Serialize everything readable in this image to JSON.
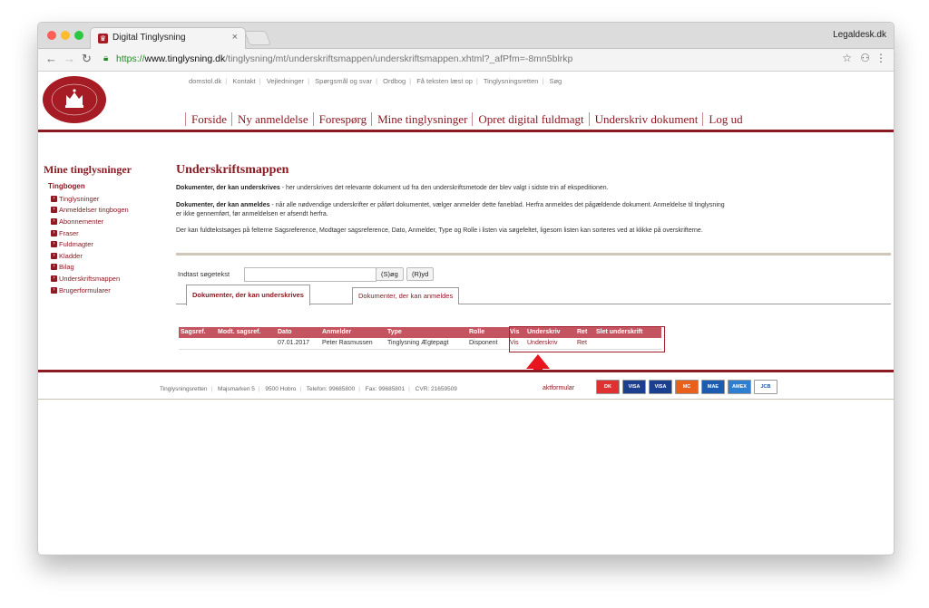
{
  "browser": {
    "tab_title": "Digital Tinglysning",
    "tab_close": "×",
    "profile_name": "Legaldesk.dk",
    "url_scheme": "https://",
    "url_host": "www.tinglysning.dk",
    "url_path": "/tinglysning/mt/underskriftsmappen/underskriftsmappen.xhtml?_afPfm=-8mn5blrkp"
  },
  "site": {
    "utility_links": [
      "domstol.dk",
      "Kontakt",
      "Vejledninger",
      "Spørgsmål og svar",
      "Ordbog",
      "Få teksten læst op",
      "Tinglysningsretten",
      "Søg"
    ],
    "main_nav": [
      "Forside",
      "Ny anmeldelse",
      "Forespørg",
      "Mine tinglysninger",
      "Opret digital fuldmagt",
      "Underskriv dokument",
      "Log ud"
    ],
    "logo_text_top": "TINGLYSNINGSRETTEN",
    "logo_text_bottom": "DANMARKS DOMSTOLE"
  },
  "sidebar": {
    "title": "Mine tinglysninger",
    "section": "Tingbogen",
    "items": [
      "Tinglysninger",
      "Anmeldelser tingbogen",
      "Abonnementer",
      "Fraser",
      "Fuldmagter",
      "Kladder",
      "Bilag",
      "Underskriftsmappen",
      "Brugerformularer"
    ]
  },
  "main": {
    "title": "Underskriftsmappen",
    "p1_bold": "Dokumenter, der kan underskrives",
    "p1_rest": " - her underskrives det relevante dokument ud fra den underskriftsmetode der blev valgt i sidste trin af ekspeditionen.",
    "p2_bold": "Dokumenter, der kan anmeldes",
    "p2_rest": " - når alle nødvendige underskrifter er påført dokumentet, vælger anmelder dette faneblad. Herfra anmeldes det pågældende dokument. Anmeldelse til tinglysning",
    "p2_line2": "er ikke gennemført, før anmeldelsen er afsendt herfra.",
    "p3": "Der kan fuldtekstsøges på felterne Sagsreference, Modtager sagsreference, Dato, Anmelder, Type og Rolle i listen via søgefeltet, ligesom listen kan sorteres ved at klikke på overskrifterne.",
    "search_label": "Indtast søgetekst",
    "search_value": "",
    "search_button": "(S)øg",
    "clear_button": "(R)yd",
    "tabs": [
      "Dokumenter, der kan underskrives",
      "Dokumenter, der kan anmeldes"
    ],
    "table": {
      "headers": [
        "Sagsref.",
        "Modt. sagsref.",
        "Dato",
        "Anmelder",
        "Type",
        "Rolle",
        "Vis",
        "Underskriv",
        "Ret",
        "Slet underskrift"
      ],
      "rows": [
        {
          "sagsref": "",
          "modt": "",
          "dato": "07.01.2017",
          "anmelder": "Peter Rasmussen",
          "type": "Tinglysning Ægtepagt",
          "rolle": "Disponent",
          "vis": "Vis",
          "underskriv": "Underskriv",
          "ret": "Ret",
          "slet": ""
        }
      ]
    }
  },
  "footer": {
    "items": [
      "Tinglysningsretten",
      "Majsmarken 5",
      "9500 Hobro",
      "Telefon: 99685800",
      "Fax: 99685801",
      "CVR: 21659509"
    ],
    "link": "aktformular",
    "cards": [
      "DK",
      "VISA",
      "VISA",
      "MC",
      "MAE",
      "AMEX",
      "JCB"
    ]
  },
  "colors": {
    "brand": "#8b1a22",
    "table_header": "#c45560",
    "arrow": "#e8141e"
  }
}
